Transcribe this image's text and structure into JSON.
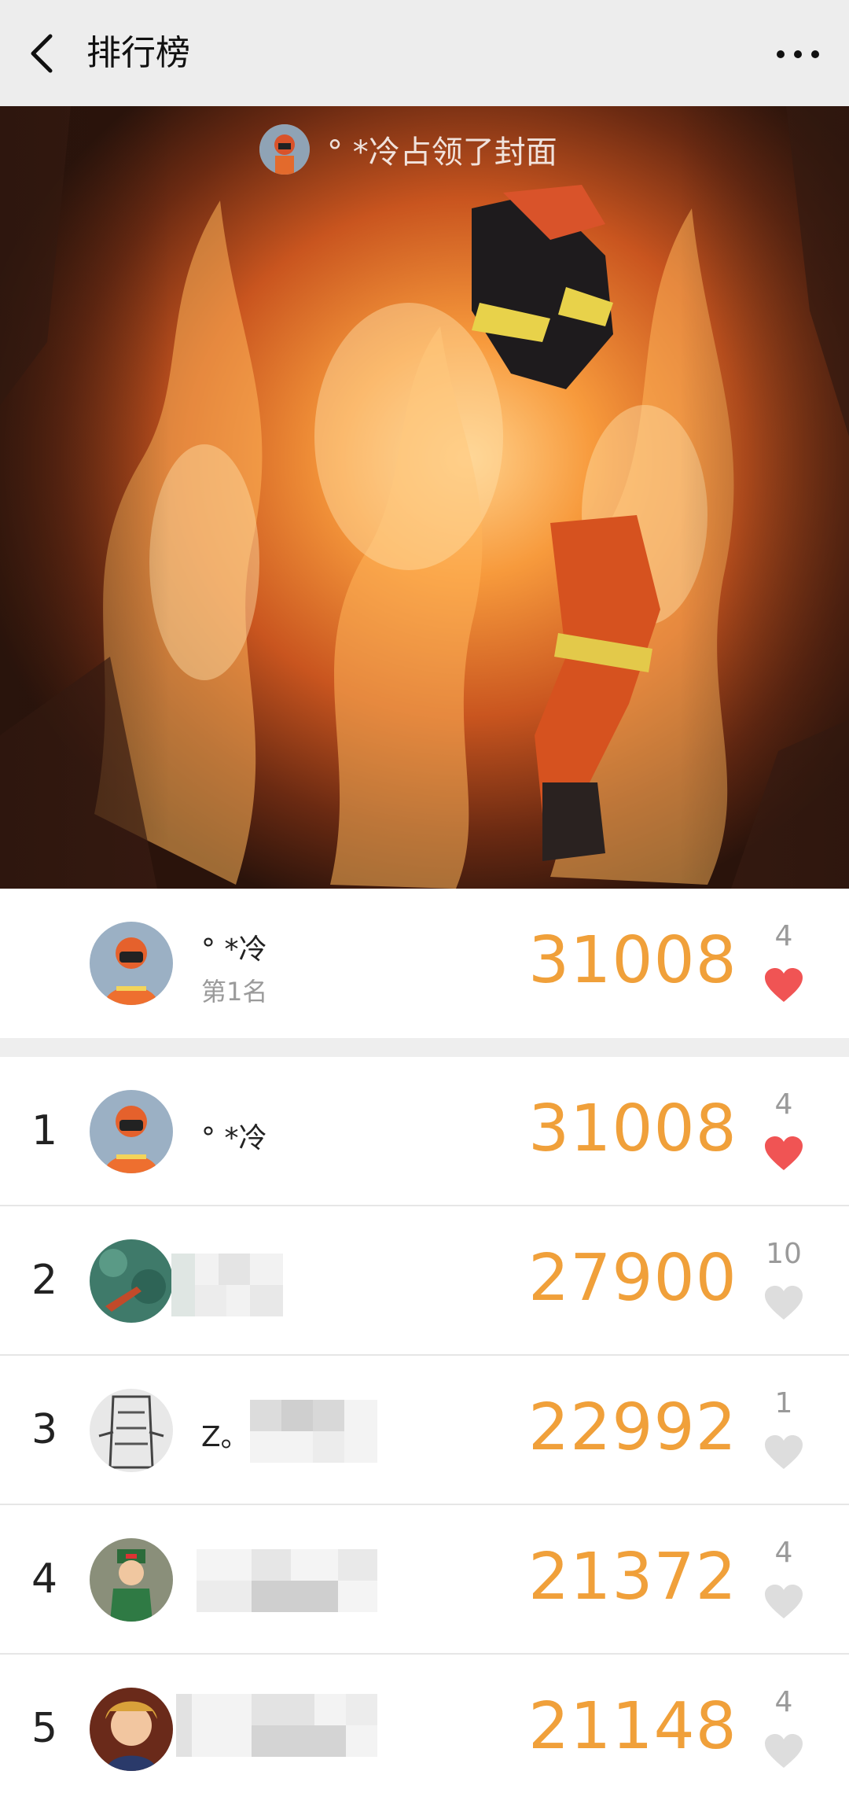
{
  "header": {
    "title": "排行榜",
    "back_icon": "chevron-left-icon",
    "more_icon": "more-horizontal-icon"
  },
  "cover": {
    "owner_text": "° *冷占领了封面"
  },
  "my_entry": {
    "name": "° *冷",
    "rank_label": "第1名",
    "score": "31008",
    "likes": "4",
    "liked": true
  },
  "rankings": [
    {
      "rank": "1",
      "name": "° *冷",
      "score": "31008",
      "likes": "4",
      "liked": true
    },
    {
      "rank": "2",
      "name": "",
      "score": "27900",
      "likes": "10",
      "liked": false
    },
    {
      "rank": "3",
      "name": "Z。",
      "score": "22992",
      "likes": "1",
      "liked": false
    },
    {
      "rank": "4",
      "name": "",
      "score": "21372",
      "likes": "4",
      "liked": false
    },
    {
      "rank": "5",
      "name": "",
      "score": "21148",
      "likes": "4",
      "liked": false
    }
  ],
  "colors": {
    "score": "#f0a03a",
    "heart_liked": "#f05454",
    "heart_unliked": "#dddddd",
    "header_bg": "#ededed"
  }
}
